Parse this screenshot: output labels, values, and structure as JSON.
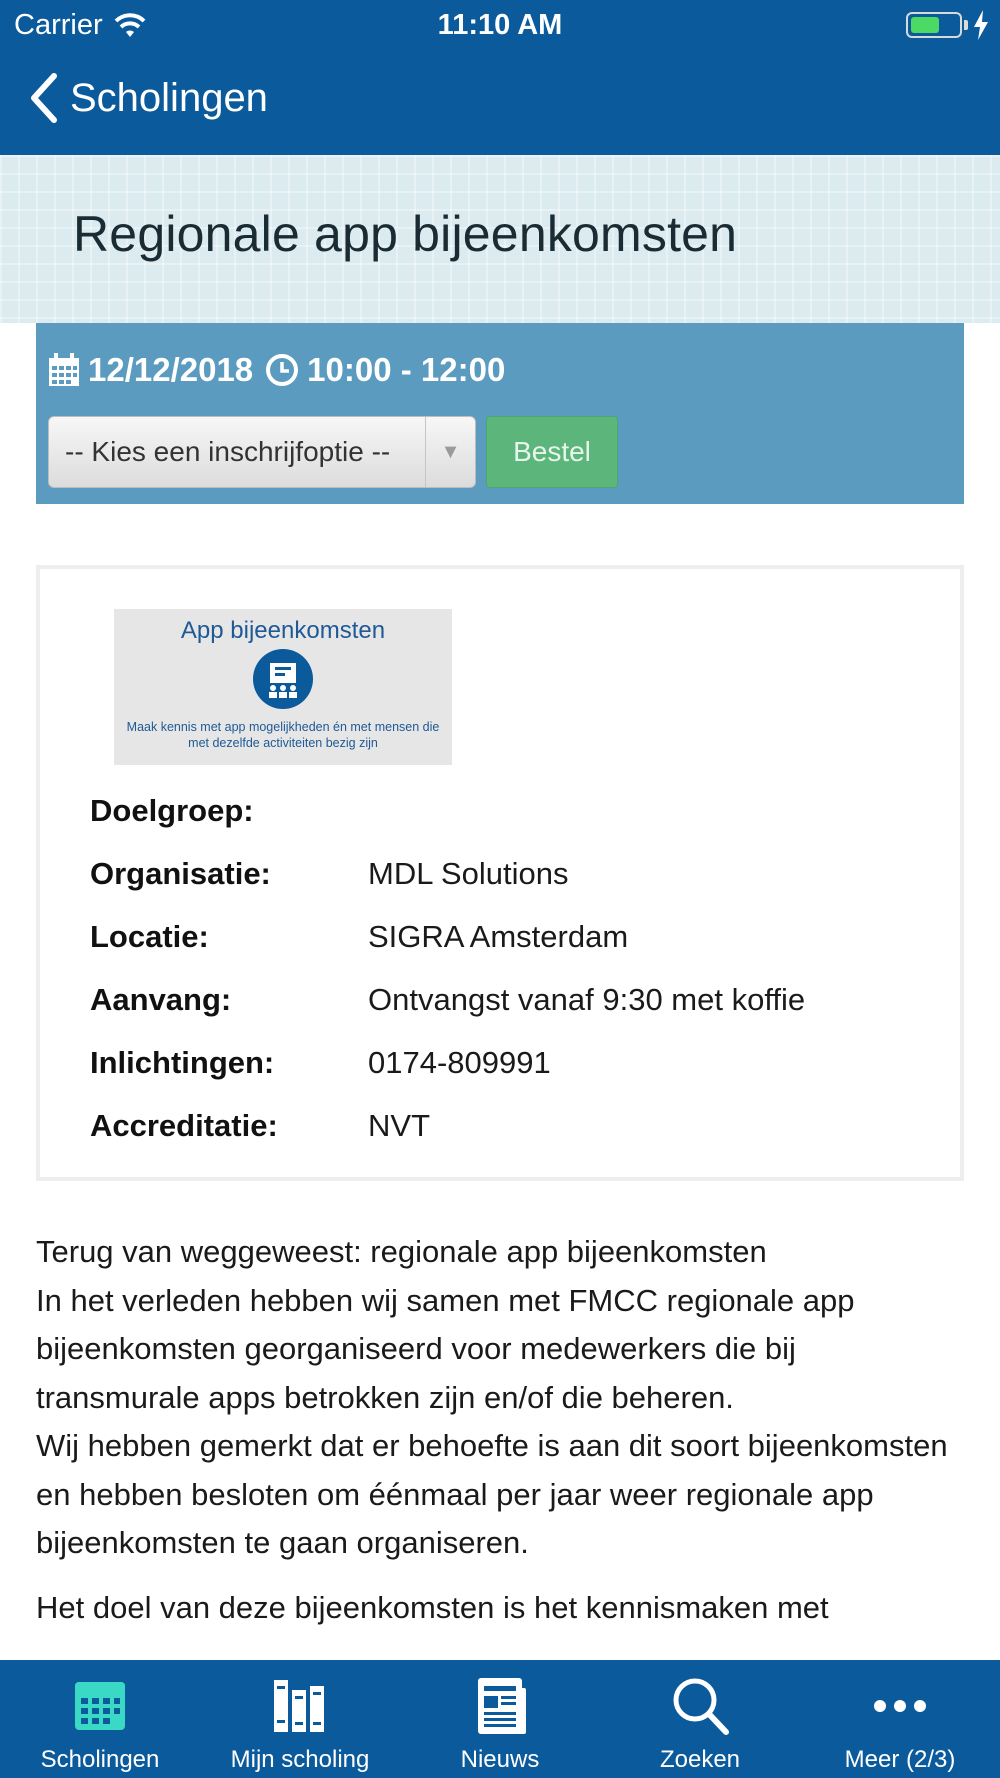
{
  "status_bar": {
    "carrier": "Carrier",
    "time": "11:10 AM"
  },
  "nav": {
    "back_label": "Scholingen"
  },
  "hero": {
    "title": "Regionale app bijeenkomsten"
  },
  "event": {
    "date": "12/12/2018",
    "time": "10:00 - 12:00",
    "select_value": "-- Kies een inschrijfoptie --",
    "order_label": "Bestel"
  },
  "promo": {
    "title": "App bijeenkomsten",
    "subtitle": "Maak kennis met app mogelijkheden én met mensen die met dezelfde activiteiten bezig zijn"
  },
  "info": [
    {
      "label": "Doelgroep:",
      "value": ""
    },
    {
      "label": "Organisatie:",
      "value": "MDL Solutions"
    },
    {
      "label": "Locatie:",
      "value": "SIGRA Amsterdam"
    },
    {
      "label": "Aanvang:",
      "value": "Ontvangst vanaf 9:30 met koffie"
    },
    {
      "label": "Inlichtingen:",
      "value": "0174-809991"
    },
    {
      "label": "Accreditatie:",
      "value": "NVT"
    }
  ],
  "description": {
    "line1": "Terug van weggeweest: regionale app bijeenkomsten",
    "line2": "In het verleden hebben wij samen met FMCC regionale app bijeenkomsten georganiseerd voor medewerkers die bij transmurale apps betrokken zijn en/of die beheren.",
    "line3": "Wij hebben gemerkt dat er behoefte is aan dit soort bijeenkomsten en hebben besloten om éénmaal per jaar weer regionale app bijeenkomsten te gaan organiseren.",
    "line4": "Het doel van deze bijeenkomsten is het kennismaken met"
  },
  "tabs": [
    {
      "label": "Scholingen",
      "icon": "calendar-icon",
      "active": true
    },
    {
      "label": "Mijn scholing",
      "icon": "books-icon",
      "active": false
    },
    {
      "label": "Nieuws",
      "icon": "newspaper-icon",
      "active": false
    },
    {
      "label": "Zoeken",
      "icon": "search-icon",
      "active": false
    },
    {
      "label": "Meer (2/3)",
      "icon": "more-icon",
      "active": false
    }
  ],
  "colors": {
    "brand": "#0a5a9c",
    "panel": "#5a9bbf",
    "order_button": "#5cb57a",
    "active_tab": "#3ad9c5"
  }
}
